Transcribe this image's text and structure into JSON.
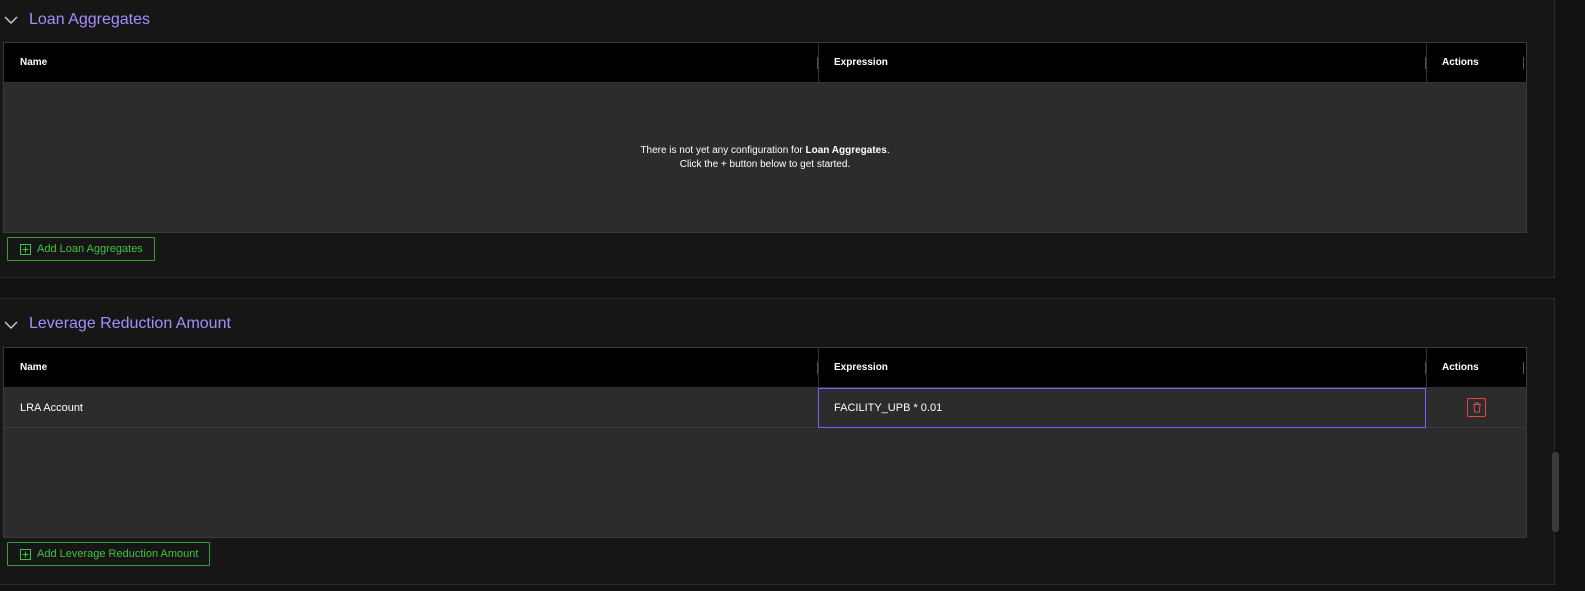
{
  "sections": [
    {
      "title": "Loan Aggregates",
      "columns": {
        "name": "Name",
        "expression": "Expression",
        "actions": "Actions"
      },
      "empty_message": {
        "line1_prefix": "There is not yet any configuration for ",
        "line1_bold": "Loan Aggregates",
        "line1_suffix": ".",
        "line2": "Click the + button below to get started."
      },
      "add_label": "Add Loan Aggregates"
    },
    {
      "title": "Leverage Reduction Amount",
      "columns": {
        "name": "Name",
        "expression": "Expression",
        "actions": "Actions"
      },
      "rows": [
        {
          "name": "LRA Account",
          "expression": "FACILITY_UPB * 0.01"
        }
      ],
      "add_label": "Add Leverage Reduction Amount"
    }
  ],
  "colors": {
    "title": "#a98bff",
    "add_button": "#41c241",
    "delete_icon": "#e04848",
    "selected_border": "#7c5cff"
  },
  "icons": {
    "collapse": "chevron-down-icon",
    "add": "plus-square-icon",
    "delete": "trash-icon"
  }
}
